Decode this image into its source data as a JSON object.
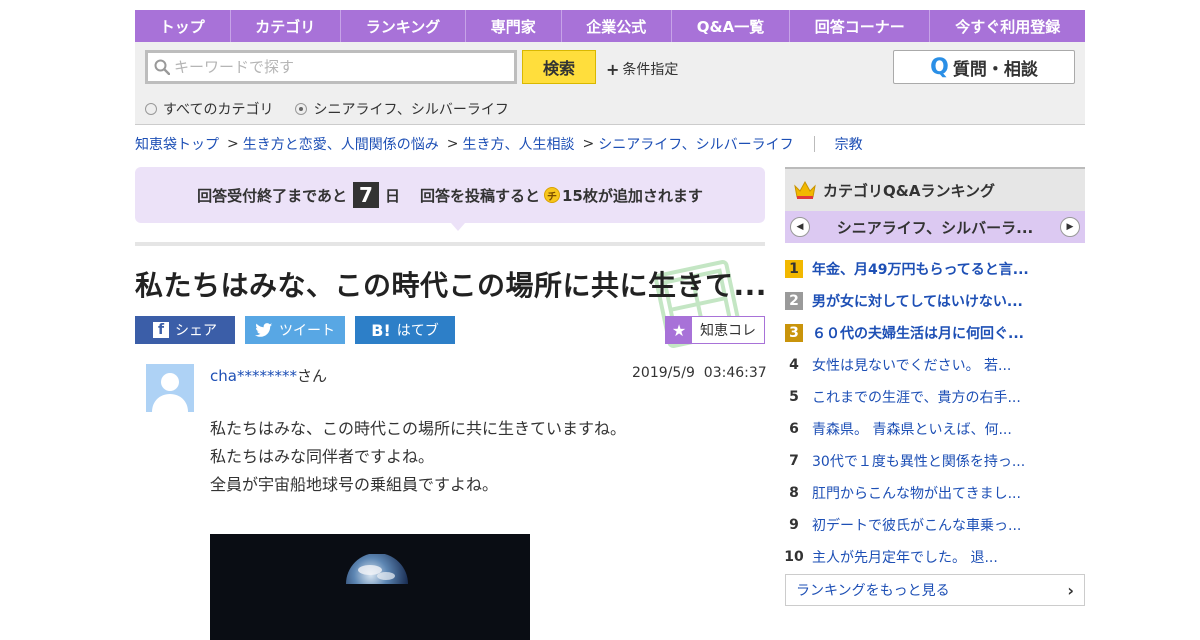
{
  "nav": {
    "items": [
      "トップ",
      "カテゴリ",
      "ランキング",
      "専門家",
      "企業公式",
      "Q&A一覧",
      "回答コーナー",
      "今すぐ利用登録"
    ]
  },
  "search": {
    "placeholder": "キーワードで探す",
    "value": "",
    "button_label": "検索",
    "conditions_label": "条件指定",
    "ask_button_label": "質問・相談",
    "radio_all": "すべてのカテゴリ",
    "radio_current": "シニアライフ、シルバーライフ",
    "selected_radio": "radio_current"
  },
  "breadcrumb": {
    "items": [
      "知恵袋トップ",
      "生き方と恋愛、人間関係の悩み",
      "生き方、人生相談",
      "シニアライフ、シルバーライフ"
    ],
    "extra": "宗教"
  },
  "notice": {
    "prefix": "回答受付終了まであと",
    "days": "7",
    "days_unit": "日",
    "middle": "回答を投稿すると",
    "coin": "チ",
    "suffix": "15枚が追加されます"
  },
  "question": {
    "title": "私たちはみな、この時代この場所に共に生きて...",
    "share": {
      "facebook": "シェア",
      "twitter": "ツイート",
      "hatena": "はてブ"
    },
    "chie_kore": "知恵コレ",
    "user_name": "cha********",
    "user_suffix": "さん",
    "date": "2019/5/9",
    "time": "03:46:37",
    "body": [
      "私たちはみな、この時代この場所に共に生きていますね。",
      "私たちはみな同伴者ですよね。",
      "全員が宇宙船地球号の乗組員ですよね。"
    ]
  },
  "ranking": {
    "title": "カテゴリQ&Aランキング",
    "category": "シニアライフ、シルバーラ...",
    "items": [
      {
        "rank": "1",
        "text": "年金、月49万円もらってると言..."
      },
      {
        "rank": "2",
        "text": "男が女に対してしてはいけない..."
      },
      {
        "rank": "3",
        "text": "６０代の夫婦生活は月に何回ぐ..."
      },
      {
        "rank": "4",
        "text": "女性は見ないでください。 若..."
      },
      {
        "rank": "5",
        "text": "これまでの生涯で、貴方の右手..."
      },
      {
        "rank": "6",
        "text": "青森県。 青森県といえば、何..."
      },
      {
        "rank": "7",
        "text": "30代で１度も異性と関係を持っ..."
      },
      {
        "rank": "8",
        "text": "肛門からこんな物が出てきまし..."
      },
      {
        "rank": "9",
        "text": "初デートで彼氏がこんな車乗っ..."
      },
      {
        "rank": "10",
        "text": "主人が先月定年でした。 退..."
      }
    ],
    "more": "ランキングをもっと見る"
  },
  "colors": {
    "nav": "#a872d8",
    "notice": "#ece2f8",
    "link": "#1d4fb5",
    "search_button": "#ffde3c"
  }
}
